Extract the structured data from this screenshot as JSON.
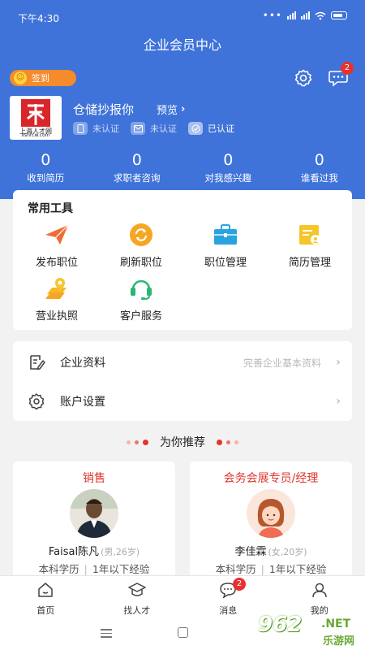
{
  "status_bar": {
    "time": "下午4:30"
  },
  "header": {
    "title": "企业会员中心",
    "signin_label": "签到",
    "message_badge": "2"
  },
  "company": {
    "logo_text": "xshrcw.com",
    "name": "仓储抄报你",
    "preview_label": "预览",
    "certifications": [
      {
        "label": "未认证"
      },
      {
        "label": "未认证"
      },
      {
        "label": "已认证"
      }
    ]
  },
  "stats": [
    {
      "value": "0",
      "label": "收到简历"
    },
    {
      "value": "0",
      "label": "求职者咨询"
    },
    {
      "value": "0",
      "label": "对我感兴趣"
    },
    {
      "value": "0",
      "label": "谁看过我"
    }
  ],
  "tools": {
    "title": "常用工具",
    "items": [
      {
        "label": "发布职位",
        "icon": "paper-plane-icon"
      },
      {
        "label": "刷新职位",
        "icon": "refresh-icon"
      },
      {
        "label": "职位管理",
        "icon": "briefcase-icon"
      },
      {
        "label": "简历管理",
        "icon": "resume-icon"
      },
      {
        "label": "营业执照",
        "icon": "license-icon"
      },
      {
        "label": "客户服务",
        "icon": "headset-icon"
      }
    ]
  },
  "menu": {
    "company_profile": {
      "label": "企业资料",
      "hint": "完善企业基本资料"
    },
    "account_settings": {
      "label": "账户设置"
    }
  },
  "recommend": {
    "title": "为你推荐",
    "candidates": [
      {
        "position": "销售",
        "name": "Faisal陈凡",
        "meta": "(男,26岁)",
        "education": "本科学历",
        "experience": "1年以下经验"
      },
      {
        "position": "会务会展专员/经理",
        "name": "李佳霖",
        "meta": "(女,20岁)",
        "education": "本科学历",
        "experience": "1年以下经验"
      }
    ]
  },
  "tabbar": {
    "items": [
      {
        "label": "首页"
      },
      {
        "label": "找人才"
      },
      {
        "label": "消息",
        "badge": "2"
      },
      {
        "label": "我的"
      }
    ]
  },
  "watermark": {
    "number": "962",
    "suffix": ".NET",
    "cn": "乐游网"
  },
  "colors": {
    "primary": "#3f73d9",
    "accent_red": "#e0352b",
    "signin_orange": "#f58b2b"
  }
}
